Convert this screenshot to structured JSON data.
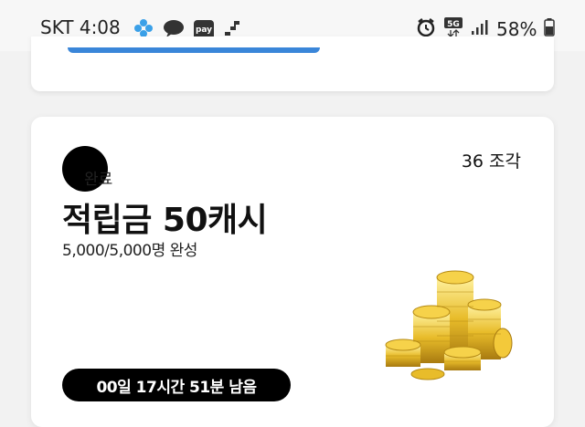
{
  "status_bar": {
    "carrier": "SKT",
    "time": "4:08",
    "battery": "58%",
    "network": "5G",
    "pay_label": "pay"
  },
  "event_card": {
    "status_badge": "완료",
    "pieces": "36 조각",
    "title": "적립금 50캐시",
    "progress": "5,000/5,000명 완성",
    "timer": "00일 17시간 51분 남음"
  }
}
